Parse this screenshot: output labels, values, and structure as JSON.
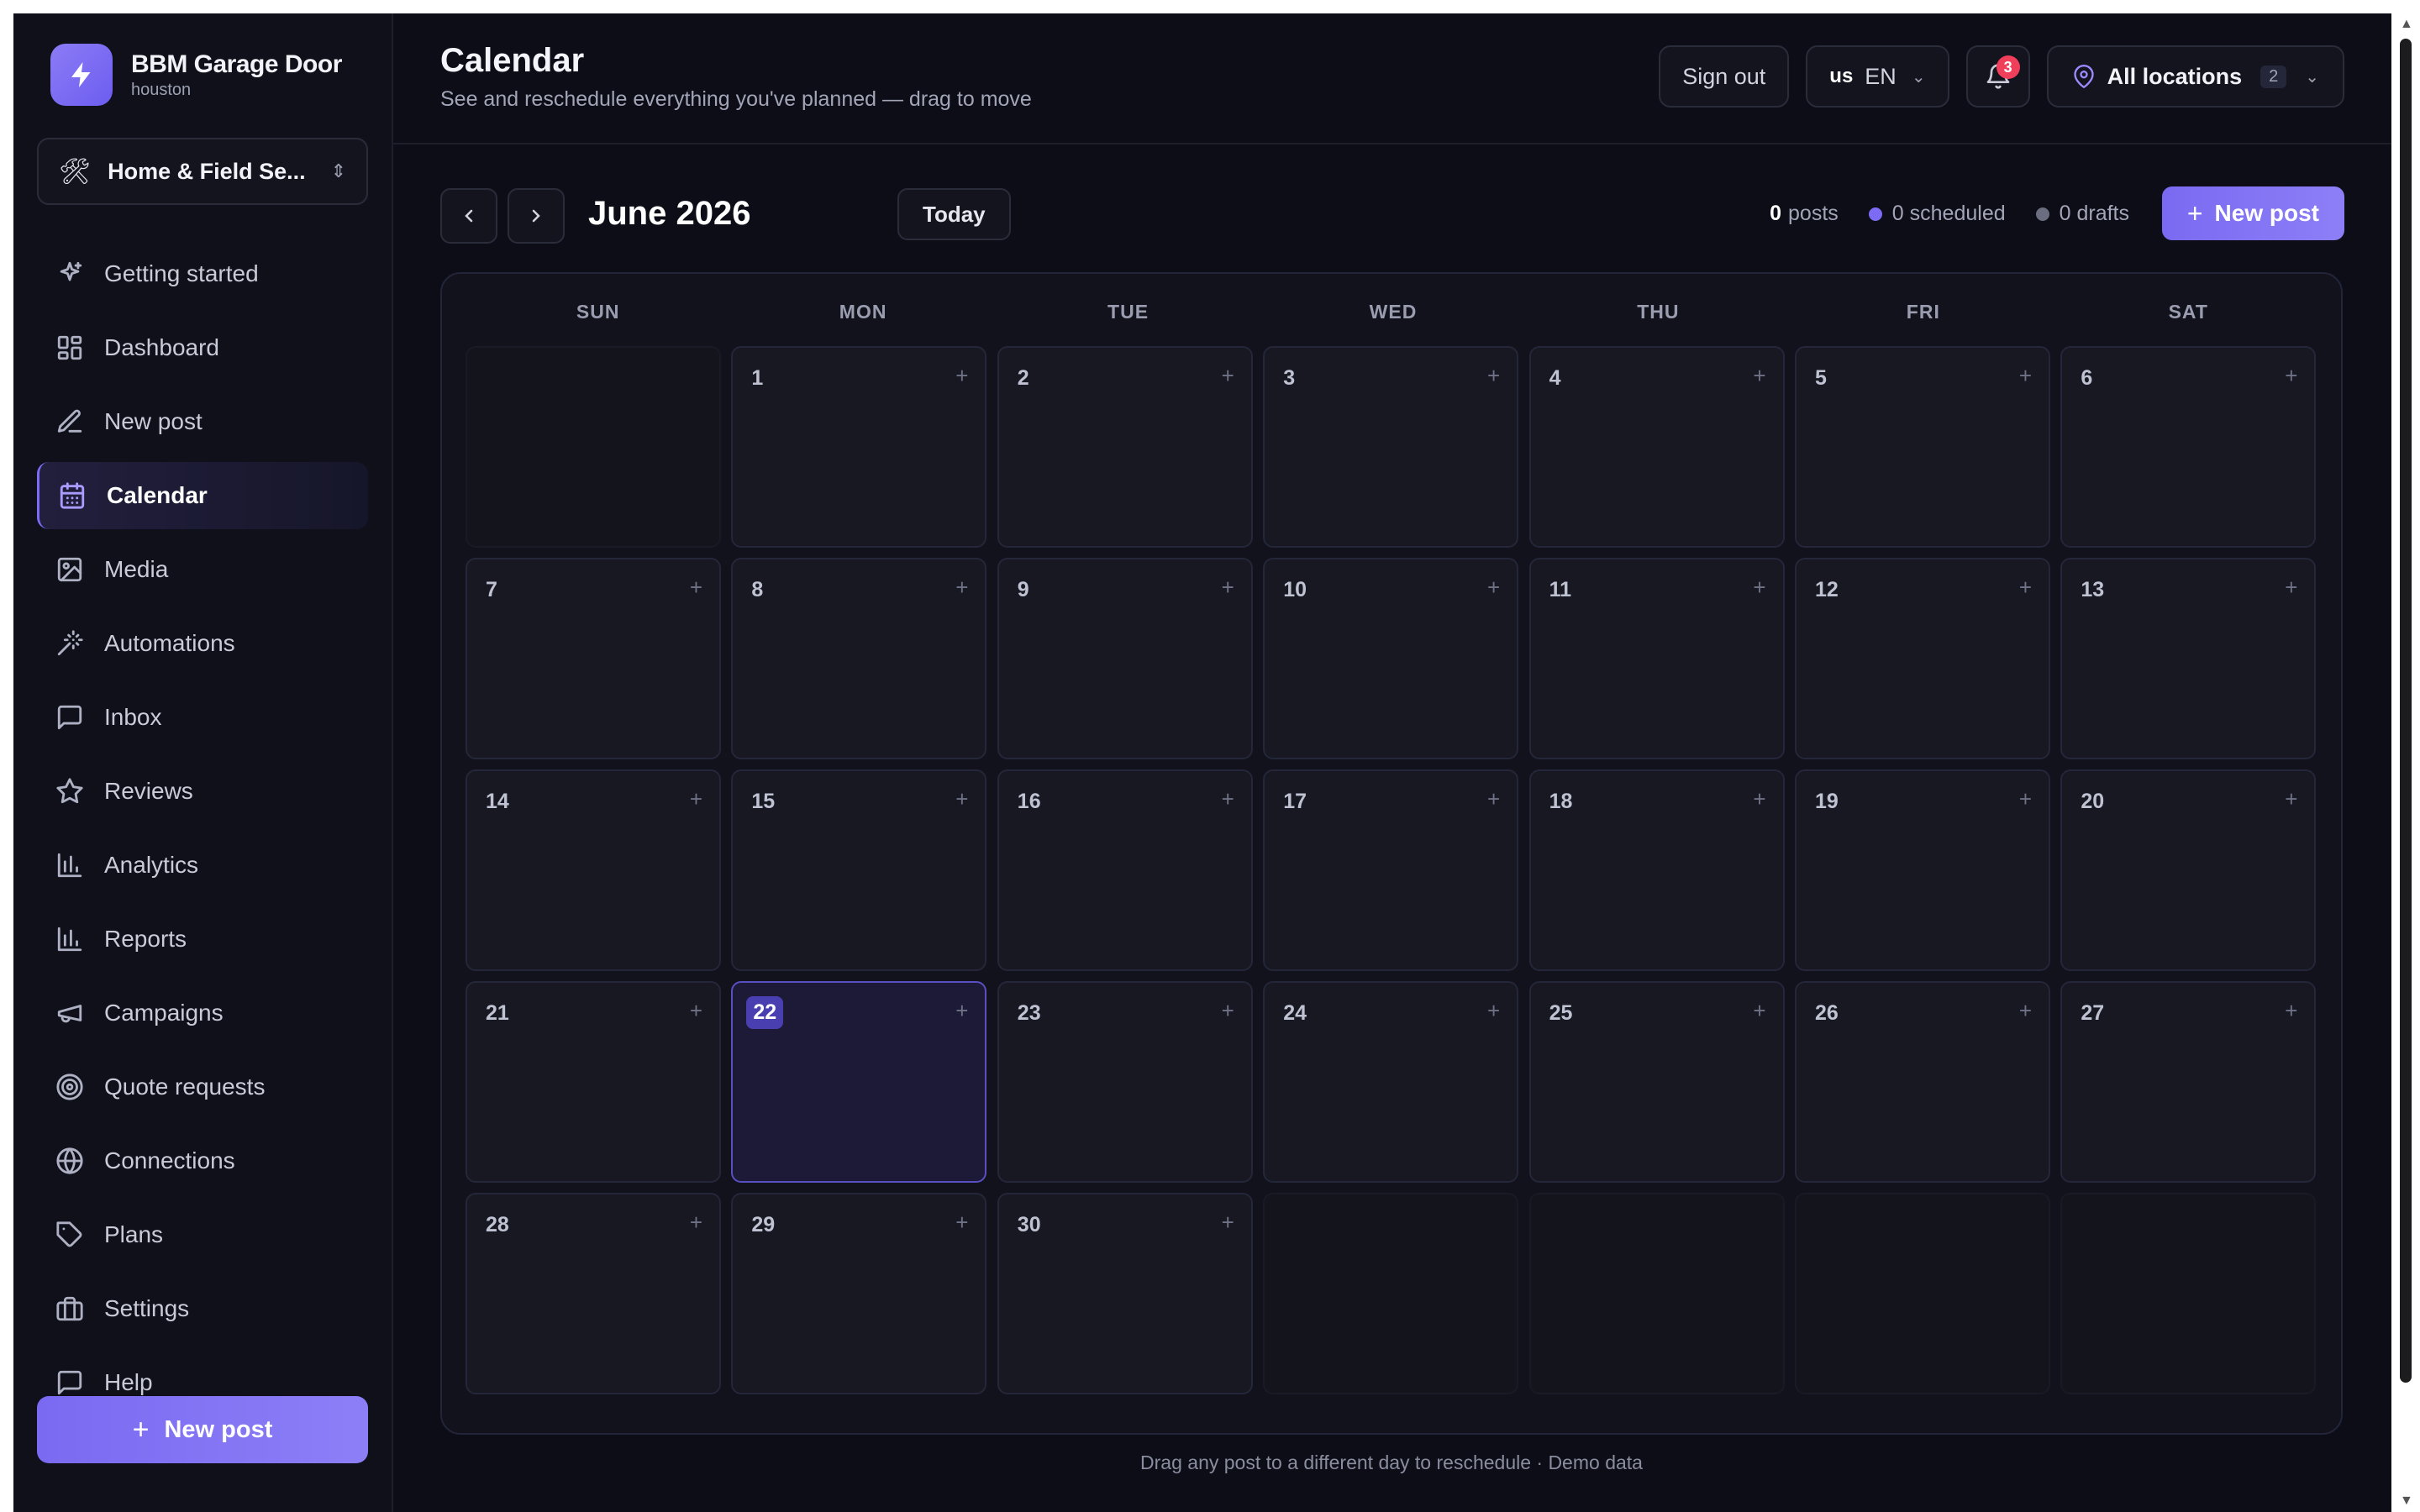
{
  "brand": {
    "name": "BBM Garage Door",
    "sub": "houston"
  },
  "workspace": {
    "icon": "tools-icon",
    "label": "Home & Field Se..."
  },
  "nav": [
    {
      "label": "Getting started",
      "icon": "sparkle-icon"
    },
    {
      "label": "Dashboard",
      "icon": "grid-icon"
    },
    {
      "label": "New post",
      "icon": "edit-icon"
    },
    {
      "label": "Calendar",
      "icon": "calendar-icon",
      "active": true
    },
    {
      "label": "Media",
      "icon": "image-icon"
    },
    {
      "label": "Automations",
      "icon": "wand-icon"
    },
    {
      "label": "Inbox",
      "icon": "message-icon"
    },
    {
      "label": "Reviews",
      "icon": "star-icon"
    },
    {
      "label": "Analytics",
      "icon": "bar-chart-icon"
    },
    {
      "label": "Reports",
      "icon": "bar-chart-icon"
    },
    {
      "label": "Campaigns",
      "icon": "megaphone-icon"
    },
    {
      "label": "Quote requests",
      "icon": "target-icon"
    },
    {
      "label": "Connections",
      "icon": "globe-icon"
    },
    {
      "label": "Plans",
      "icon": "tag-icon"
    },
    {
      "label": "Settings",
      "icon": "briefcase-icon"
    },
    {
      "label": "Help",
      "icon": "chat-icon"
    }
  ],
  "sidebar_new_post": "New post",
  "header": {
    "title": "Calendar",
    "subtitle": "See and reschedule everything you've planned — drag to move",
    "sign_out": "Sign out",
    "lang_flag": "us",
    "lang": "EN",
    "notifications": "3",
    "location": "All locations",
    "location_count": "2"
  },
  "calendar": {
    "month": "June 2026",
    "today_label": "Today",
    "posts_count": "0",
    "posts_label": "posts",
    "scheduled": "0 scheduled",
    "drafts": "0 drafts",
    "new_post": "New post",
    "days_of_week": [
      "SUN",
      "MON",
      "TUE",
      "WED",
      "THU",
      "FRI",
      "SAT"
    ],
    "first_weekday": 1,
    "days_in_month": 30,
    "today": 22,
    "add_symbol": "+"
  },
  "footer_note": "Drag any post to a different day to reschedule · Demo data",
  "colors": {
    "accent": "#7a6af2",
    "scheduled_dot": "#7c6cf4",
    "drafts_dot": "#6b6e80",
    "badge": "#ef3f5a"
  }
}
